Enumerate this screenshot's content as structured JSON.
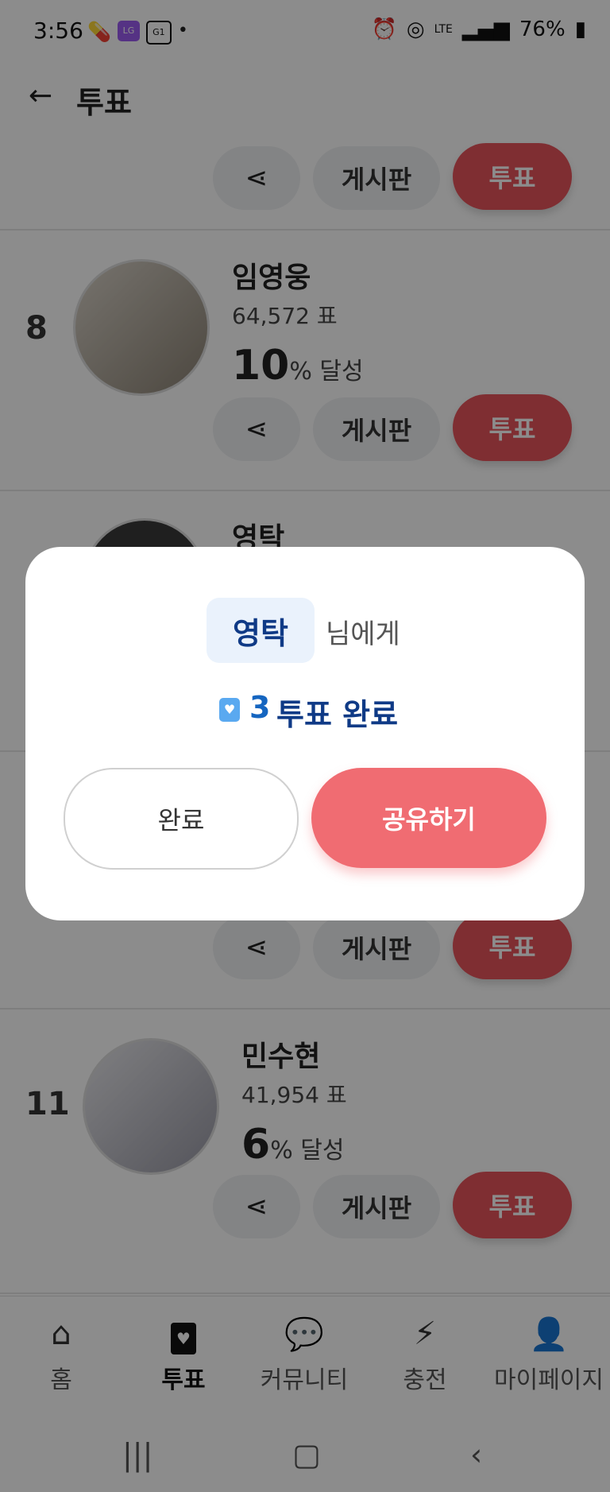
{
  "status": {
    "time": "3:56",
    "battery": "76%",
    "net": "LTE"
  },
  "header": {
    "title": "투표"
  },
  "actions": {
    "board": "게시판",
    "vote": "투표"
  },
  "rows": [
    {
      "rank": "8",
      "name": "임영웅",
      "votes": "64,572 표",
      "percent": "10",
      "pct_label": "% 달성"
    },
    {
      "rank": "",
      "name": "영탁",
      "votes": "",
      "percent": "",
      "pct_label": ""
    },
    {
      "rank": "11",
      "name": "민수현",
      "votes": "41,954 표",
      "percent": "6",
      "pct_label": "% 달성"
    }
  ],
  "dialog": {
    "recipient": "영탁",
    "suffix": "님에게",
    "count": "3",
    "done_text": "투표 완료",
    "btn_done": "완료",
    "btn_share": "공유하기"
  },
  "nav": [
    {
      "label": "홈",
      "icon": "home-icon"
    },
    {
      "label": "투표",
      "icon": "vote-heart-icon"
    },
    {
      "label": "커뮤니티",
      "icon": "chat-icon"
    },
    {
      "label": "충전",
      "icon": "lightning-icon"
    },
    {
      "label": "마이페이지",
      "icon": "person-icon"
    }
  ]
}
